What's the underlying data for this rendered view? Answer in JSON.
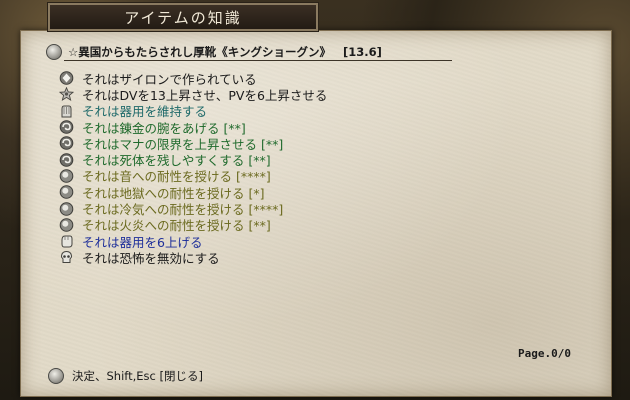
{
  "window": {
    "title": "アイテムの知識"
  },
  "item": {
    "name": "☆異国からもたらされし厚靴《キングショーグン》",
    "weight": "[13.6]"
  },
  "properties": [
    {
      "icon": "gem-icon",
      "text": "それはザイロンで作られている",
      "color": "#1b1b1b"
    },
    {
      "icon": "star-icon",
      "text": "それはDVを13上昇させ、PVを6上昇させる",
      "color": "#1b1b1b"
    },
    {
      "icon": "glove-icon",
      "text": "それは器用を維持する",
      "color": "#1f6a6a"
    },
    {
      "icon": "swirl-icon",
      "text": "それは錬金の腕をあげる [**]",
      "color": "#1f6a2c"
    },
    {
      "icon": "swirl-icon",
      "text": "それはマナの限界を上昇させる [**]",
      "color": "#1f6a2c"
    },
    {
      "icon": "swirl-icon",
      "text": "それは死体を残しやすくする [**]",
      "color": "#1f6a2c"
    },
    {
      "icon": "orb-icon",
      "text": "それは音への耐性を授ける [****]",
      "color": "#6b6a1f"
    },
    {
      "icon": "orb-icon",
      "text": "それは地獄への耐性を授ける [*]",
      "color": "#6b6a1f"
    },
    {
      "icon": "orb-icon",
      "text": "それは冷気への耐性を授ける [****]",
      "color": "#6b6a1f"
    },
    {
      "icon": "orb-icon",
      "text": "それは火炎への耐性を授ける [**]",
      "color": "#6b6a1f"
    },
    {
      "icon": "fist-icon",
      "text": "それは器用を6上げる",
      "color": "#1e2f9a"
    },
    {
      "icon": "skull-icon",
      "text": "それは恐怖を無効にする",
      "color": "#1b1b1b"
    }
  ],
  "page_indicator": "Page.0/0",
  "footer": {
    "hint": "決定、Shift,Esc [閉じる]"
  }
}
